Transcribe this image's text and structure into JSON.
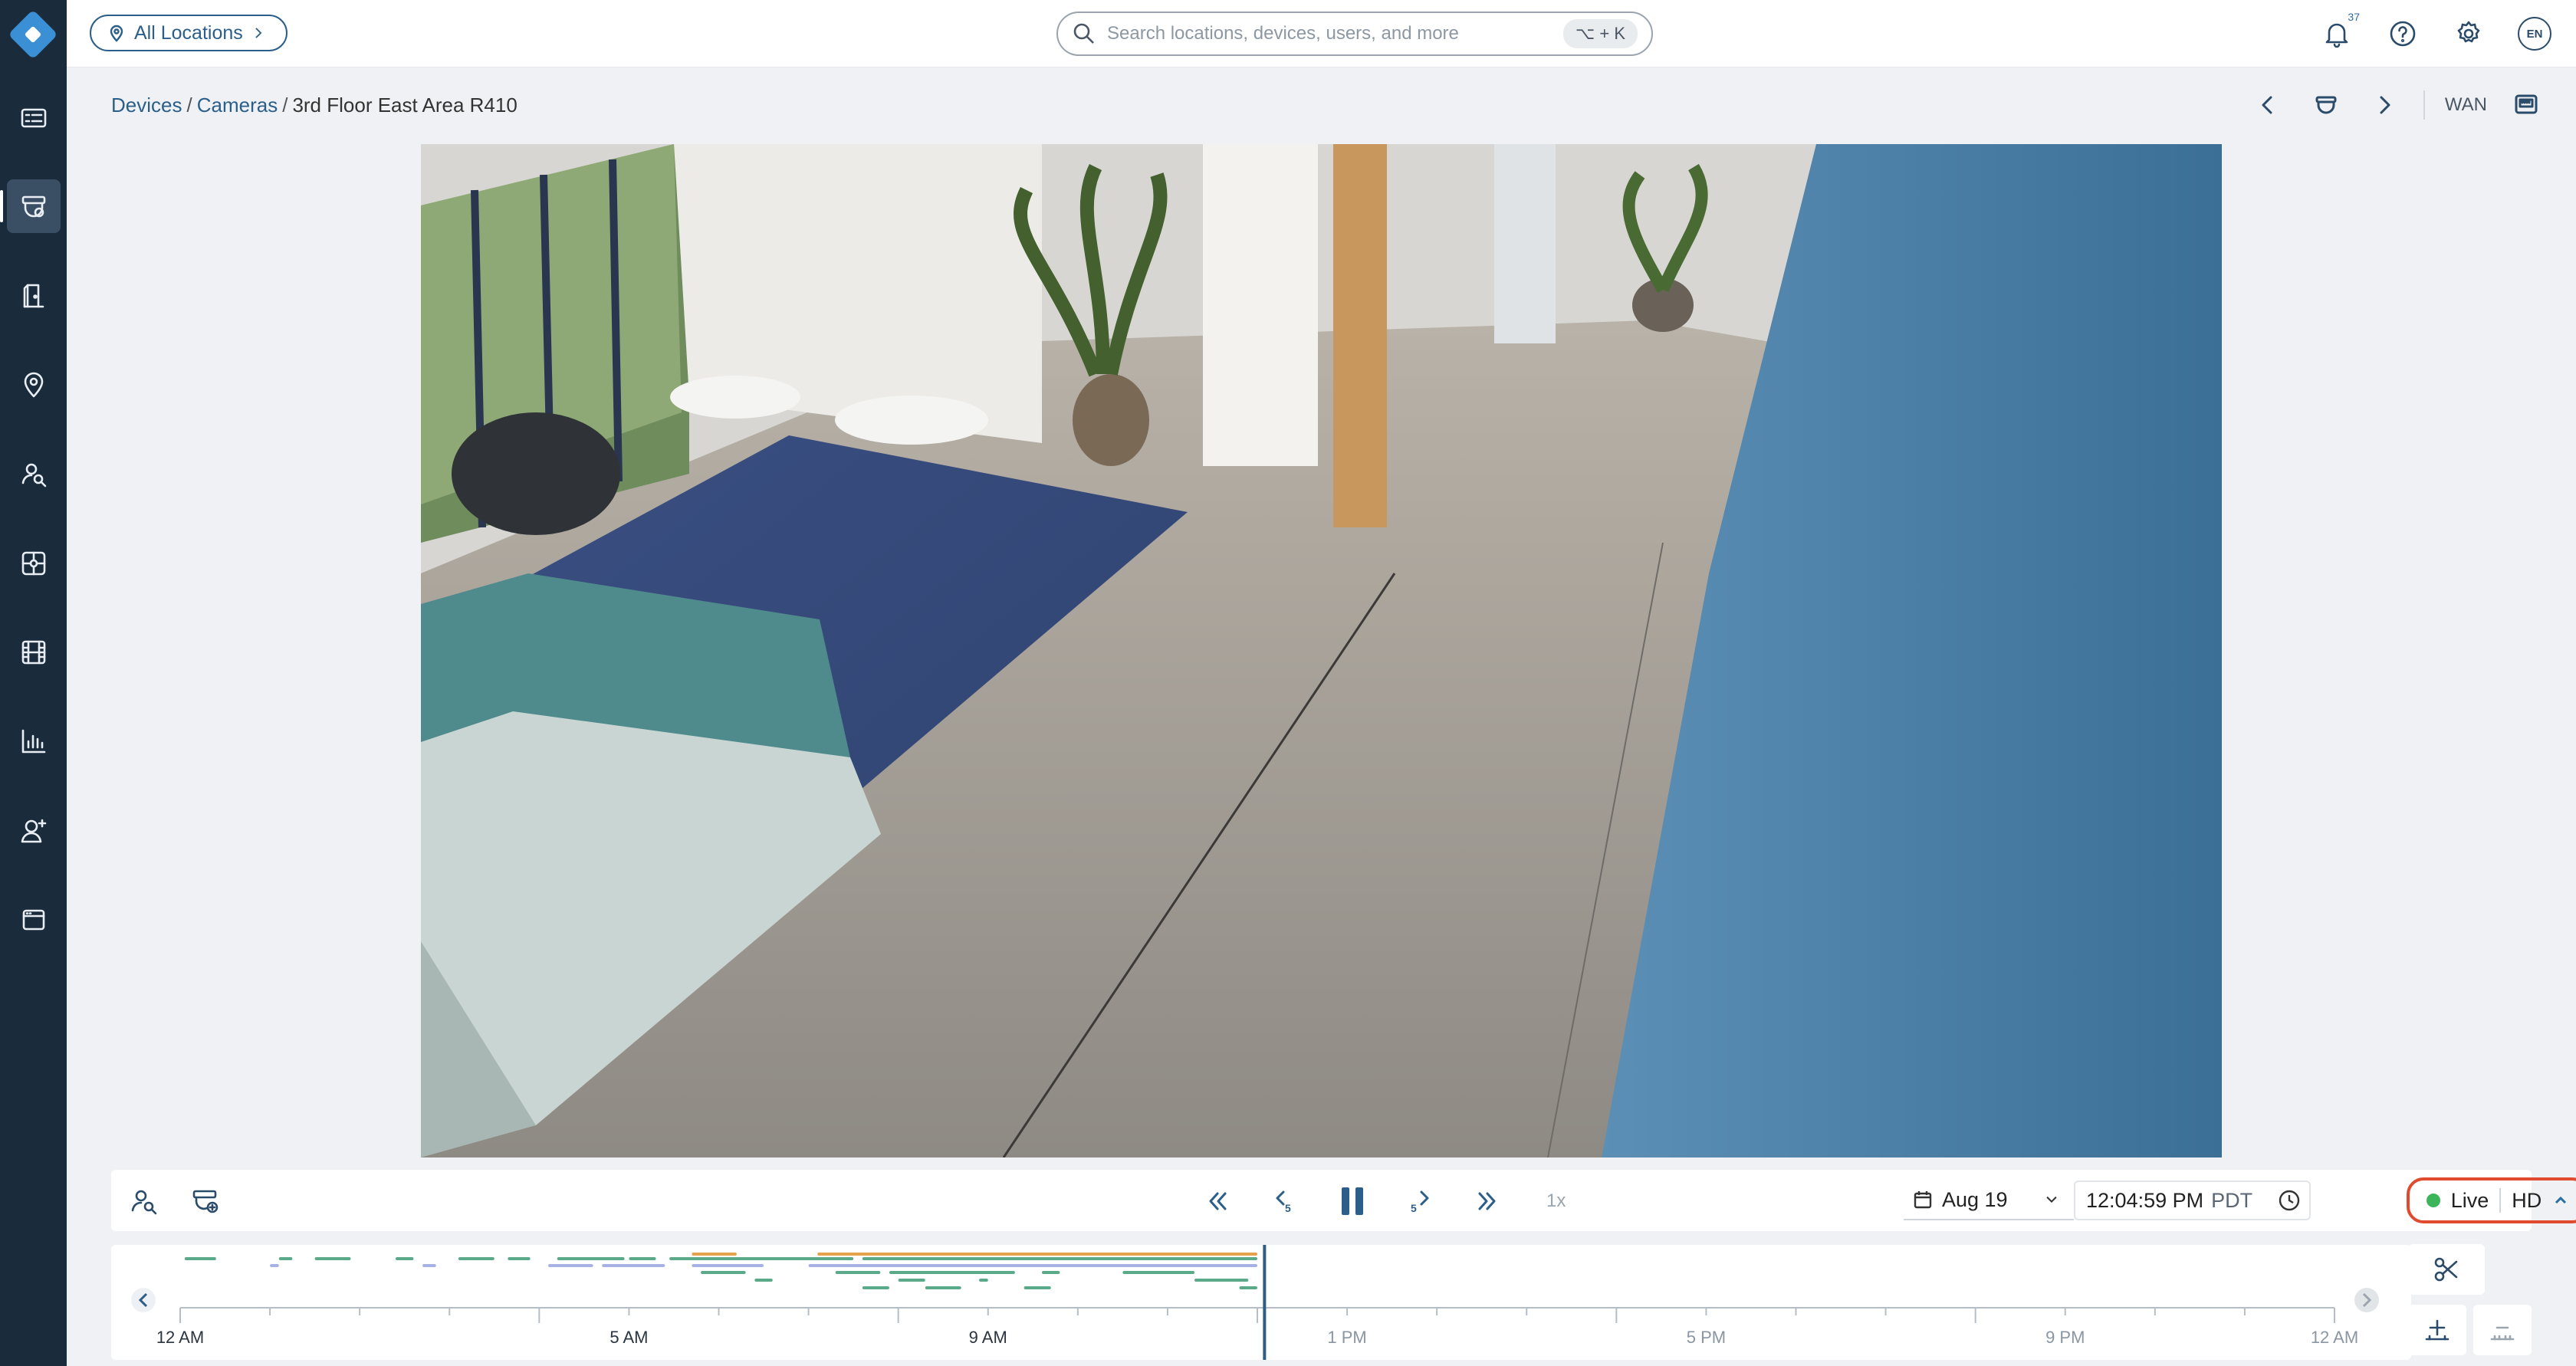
{
  "sidebar": {
    "items": [
      {
        "name": "nav-devices-list",
        "icon": "device-list-icon"
      },
      {
        "name": "nav-cameras",
        "icon": "camera-icon",
        "active": true
      },
      {
        "name": "nav-access-control",
        "icon": "door-icon"
      },
      {
        "name": "nav-locations",
        "icon": "location-pin-icon"
      },
      {
        "name": "nav-people-search",
        "icon": "person-search-icon"
      },
      {
        "name": "nav-integrations",
        "icon": "hub-icon"
      },
      {
        "name": "nav-video-archive",
        "icon": "film-icon"
      },
      {
        "name": "nav-analytics",
        "icon": "bar-chart-icon"
      },
      {
        "name": "nav-users",
        "icon": "add-user-icon"
      },
      {
        "name": "nav-apps",
        "icon": "window-icon"
      }
    ]
  },
  "header": {
    "location_label": "All Locations",
    "search_placeholder": "Search locations, devices, users, and more",
    "search_shortcut": "⌥ + K",
    "notification_count": "37",
    "language": "EN"
  },
  "breadcrumb": {
    "items": [
      "Devices",
      "Cameras"
    ],
    "current": "3rd Floor East Area R410",
    "separator": "/"
  },
  "camera_controls": {
    "network_label": "WAN"
  },
  "playback": {
    "speed": "1x",
    "date": "Aug 19",
    "time": "12:04:59 PM",
    "timezone": "PDT",
    "live_label": "Live",
    "quality": "HD"
  },
  "timeline": {
    "tick_labels": [
      "12 AM",
      "5 AM",
      "9 AM",
      "1 PM",
      "5 PM",
      "9 PM",
      "12 AM"
    ],
    "colors": {
      "green": "#5aaa8a",
      "orange": "#e6a24a",
      "purple": "#a7b1e6",
      "cursor": "#2b5f8a"
    }
  }
}
